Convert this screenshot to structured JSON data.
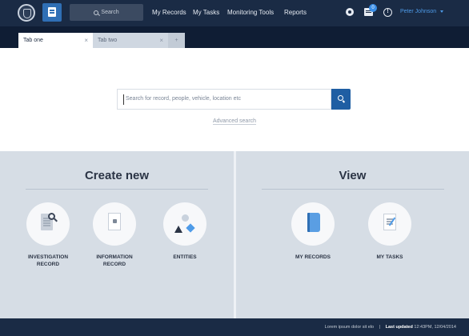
{
  "topbar": {
    "search_label": "Search",
    "nav": [
      "My Records",
      "My Tasks",
      "Monitoring Tools",
      "Reports"
    ],
    "notification_count": "0",
    "info_glyph": "!",
    "user_name": "Peter Johnson"
  },
  "tabs": [
    {
      "label": "Tab one",
      "close": "×"
    },
    {
      "label": "Tab two",
      "close": "×"
    },
    {
      "label": "+"
    }
  ],
  "search": {
    "placeholder": "Search for record, people, vehicle, location etc",
    "advanced_link": "Advanced search"
  },
  "create_new": {
    "title": "Create new",
    "items": [
      {
        "label_line1": "INVESTIGATION",
        "label_line2": "RECORD",
        "icon": "investigation-record-icon"
      },
      {
        "label_line1": "INFORMATION",
        "label_line2": "RECORD",
        "icon": "information-record-icon"
      },
      {
        "label_line1": "ENTITIES",
        "label_line2": "",
        "icon": "entities-icon"
      }
    ]
  },
  "view": {
    "title": "View",
    "items": [
      {
        "label_line1": "MY RECORDS",
        "label_line2": "",
        "icon": "my-records-icon"
      },
      {
        "label_line1": "MY TASKS",
        "label_line2": "",
        "icon": "my-tasks-icon"
      }
    ]
  },
  "footer": {
    "lorem": "Lorem ipsum dolor sit elo",
    "separator": "|",
    "last_updated_label": "Last updated",
    "last_updated_value": "12:43PM, 12/04/2014"
  },
  "colors": {
    "nav_bg": "#1a2b45",
    "accent": "#1f5ea3",
    "panel_bg": "#d6dde5",
    "user_link": "#4e9be8"
  }
}
